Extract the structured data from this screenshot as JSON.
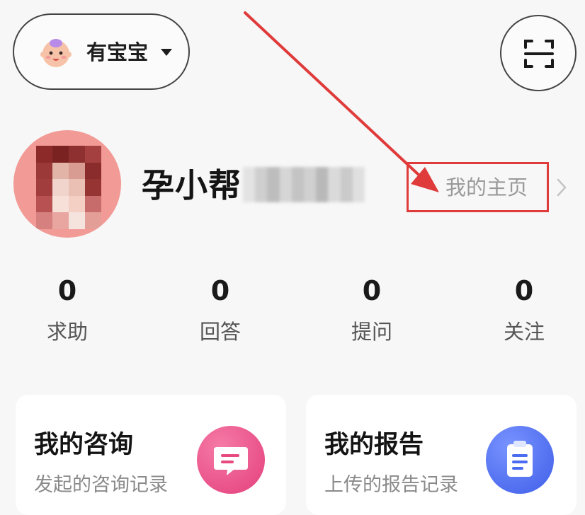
{
  "header": {
    "status_label": "有宝宝",
    "status_icon": "baby-face-icon",
    "scan_icon": "scan-icon"
  },
  "profile": {
    "name": "孕小帮",
    "name_obscured": true,
    "avatar_obscured": true,
    "homepage_label": "我的主页",
    "homepage_chevron": "chevron-right-icon"
  },
  "stats": [
    {
      "value": "0",
      "label": "求助"
    },
    {
      "value": "0",
      "label": "回答"
    },
    {
      "value": "0",
      "label": "提问"
    },
    {
      "value": "0",
      "label": "关注"
    }
  ],
  "cards": [
    {
      "title": "我的咨询",
      "subtitle": "发起的咨询记录",
      "icon": "chat-bubble-icon",
      "color": "#ec4f87"
    },
    {
      "title": "我的报告",
      "subtitle": "上传的报告记录",
      "icon": "clipboard-icon",
      "color": "#4a6cf0"
    }
  ],
  "colors": {
    "background": "#f7f7f7",
    "annotation": "#e03b3b",
    "avatar_bg": "#f29a96",
    "muted_text": "#9a9a9a"
  }
}
